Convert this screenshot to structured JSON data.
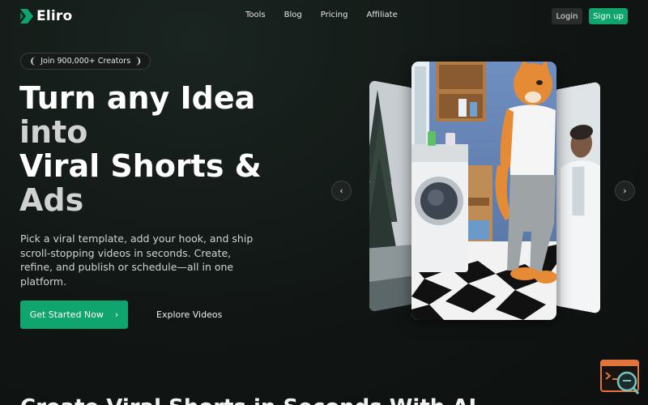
{
  "brand": {
    "name": "Eliro",
    "accent": "#10a56f"
  },
  "nav": {
    "links": [
      "Tools",
      "Blog",
      "Pricing",
      "Affiliate"
    ],
    "login_label": "Login",
    "signup_label": "Sign up"
  },
  "hero": {
    "badge": "Join 900,000+ Creators",
    "headline_line1": "Turn any Idea",
    "headline_line2": "into",
    "headline_line3": "Viral Shorts &",
    "headline_line4": "Ads",
    "subtext": "Pick a viral template, add your hook, and ship scroll-stopping videos in seconds. Create, refine, and publish or schedule—all in one platform.",
    "cta_primary": "Get Started Now",
    "cta_secondary": "Explore Videos"
  },
  "carousel": {
    "prev_icon": "chevron-left-icon",
    "next_icon": "chevron-right-icon"
  },
  "section": {
    "title": "Create Viral Shorts in Seconds With AI"
  }
}
